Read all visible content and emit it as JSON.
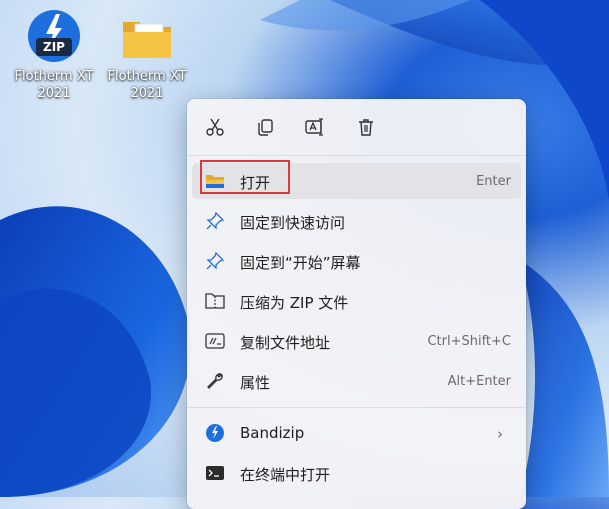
{
  "desktop": {
    "icons": [
      {
        "label_line1": "Flotherm XT",
        "label_line2": "2021",
        "icon": "zip-archive-icon",
        "badge": "ZIP"
      },
      {
        "label_line1": "Flotherm XT",
        "label_line2": "2021",
        "icon": "folder-icon"
      }
    ]
  },
  "context_menu": {
    "quick_actions": [
      {
        "name": "cut",
        "icon": "scissors-icon"
      },
      {
        "name": "copy",
        "icon": "copy-icon"
      },
      {
        "name": "rename",
        "icon": "rename-icon"
      },
      {
        "name": "delete",
        "icon": "trash-icon"
      }
    ],
    "items": [
      {
        "label": "打开",
        "shortcut": "Enter",
        "icon": "folder-icon",
        "highlighted": true
      },
      {
        "label": "固定到快速访问",
        "shortcut": "",
        "icon": "pin-icon"
      },
      {
        "label": "固定到“开始”屏幕",
        "shortcut": "",
        "icon": "pin-icon"
      },
      {
        "label": "压缩为 ZIP 文件",
        "shortcut": "",
        "icon": "zip-folder-icon"
      },
      {
        "label": "复制文件地址",
        "shortcut": "Ctrl+Shift+C",
        "icon": "path-icon"
      },
      {
        "label": "属性",
        "shortcut": "Alt+Enter",
        "icon": "wrench-icon"
      },
      {
        "label": "Bandizip",
        "shortcut": "",
        "icon": "bandizip-icon",
        "submenu": true
      },
      {
        "label": "在终端中打开",
        "shortcut": "",
        "icon": "terminal-icon"
      }
    ],
    "colors": {
      "highlight_border": "#d93b3b",
      "accent": "#1d6fe0"
    }
  }
}
